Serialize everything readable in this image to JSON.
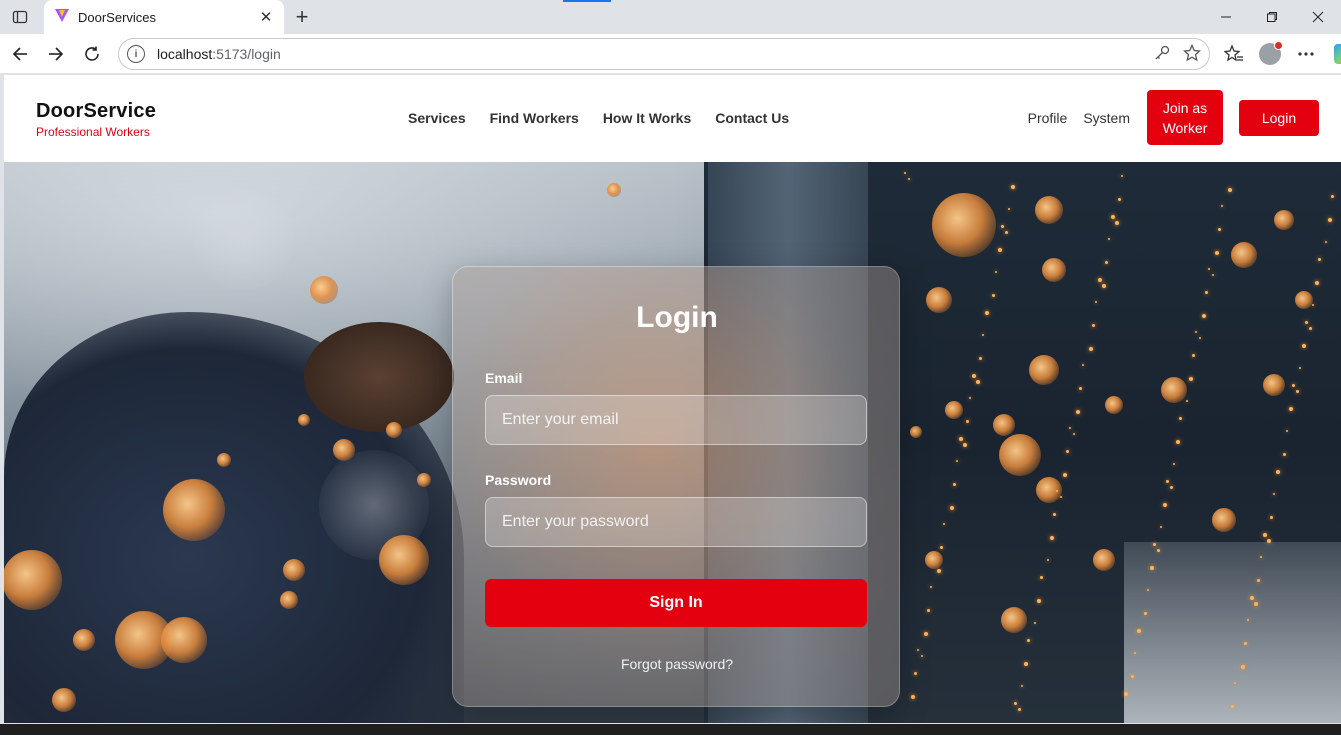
{
  "browser": {
    "tab_title": "DoorServices",
    "url_host": "localhost",
    "url_path": ":5173/login",
    "icons": [
      "sidebar-toggle-icon",
      "close-icon",
      "new-tab-icon",
      "minimize-icon",
      "maximize-icon",
      "window-close-icon",
      "back-icon",
      "forward-icon",
      "refresh-icon",
      "info-icon",
      "key-icon",
      "star-icon",
      "favorites-icon",
      "profile-icon",
      "more-icon",
      "copilot-icon"
    ]
  },
  "site": {
    "brand_name": "DoorService",
    "brand_tagline": "Professional Workers",
    "nav": [
      "Services",
      "Find Workers",
      "How It Works",
      "Contact Us"
    ],
    "right_links": [
      "Profile",
      "System"
    ],
    "join_button": "Join as Worker",
    "login_button": "Login",
    "accent_color": "#e3000f"
  },
  "login_form": {
    "title": "Login",
    "email_label": "Email",
    "email_placeholder": "Enter your email",
    "email_value": "",
    "password_label": "Password",
    "password_placeholder": "Enter your password",
    "password_value": "",
    "submit_label": "Sign In",
    "forgot_link": "Forgot password?"
  }
}
